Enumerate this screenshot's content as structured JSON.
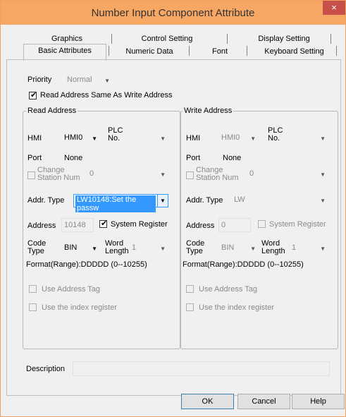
{
  "window": {
    "title": "Number Input Component Attribute",
    "close_glyph": "×"
  },
  "tabs": {
    "row1": [
      "Graphics",
      "Control Setting",
      "Display Setting"
    ],
    "row2": [
      "Basic Attributes",
      "Numeric Data",
      "Font",
      "Keyboard Setting"
    ]
  },
  "priority": {
    "label": "Priority",
    "value": "Normal"
  },
  "same_address": {
    "label": "Read Address Same As Write Address",
    "checked": true
  },
  "read": {
    "title": "Read Address",
    "hmi_label": "HMI",
    "hmi_value": "HMI0",
    "plc_label_1": "PLC",
    "plc_label_2": "No.",
    "plc_value": "",
    "port_label": "Port",
    "port_value": "None",
    "change_label_1": "Change",
    "change_label_2": "Station Num",
    "change_value": "0",
    "addr_type_label": "Addr. Type",
    "addr_type_value": "LW10148:Set the passw",
    "address_label": "Address",
    "address_value": "10148",
    "sysreg_label": "System Register",
    "code_label_1": "Code",
    "code_label_2": "Type",
    "code_value": "BIN",
    "word_label_1": "Word",
    "word_label_2": "Length",
    "word_value": "1",
    "format": "Format(Range):DDDDD (0--10255)",
    "tag_label": "Use Address Tag",
    "index_label": "Use the index register"
  },
  "write": {
    "title": "Write Address",
    "hmi_label": "HMI",
    "hmi_value": "HMI0",
    "plc_label_1": "PLC",
    "plc_label_2": "No.",
    "plc_value": "",
    "port_label": "Port",
    "port_value": "None",
    "change_label_1": "Change",
    "change_label_2": "Station Num",
    "change_value": "0",
    "addr_type_label": "Addr. Type",
    "addr_type_value": "LW",
    "address_label": "Address",
    "address_value": "0",
    "sysreg_label": "System Register",
    "code_label_1": "Code",
    "code_label_2": "Type",
    "code_value": "BIN",
    "word_label_1": "Word",
    "word_label_2": "Length",
    "word_value": "1",
    "format": "Format(Range):DDDDD (0--10255)",
    "tag_label": "Use Address Tag",
    "index_label": "Use the index register"
  },
  "description": {
    "label": "Description",
    "value": ""
  },
  "buttons": {
    "ok": "OK",
    "cancel": "Cancel",
    "help": "Help"
  },
  "icons": {
    "dropdown": "chevron-down-icon",
    "check": "checkmark-icon",
    "close": "close-icon"
  },
  "colors": {
    "title_bar": "#f6a764",
    "close_button": "#c7504b",
    "selection": "#3399ff"
  }
}
